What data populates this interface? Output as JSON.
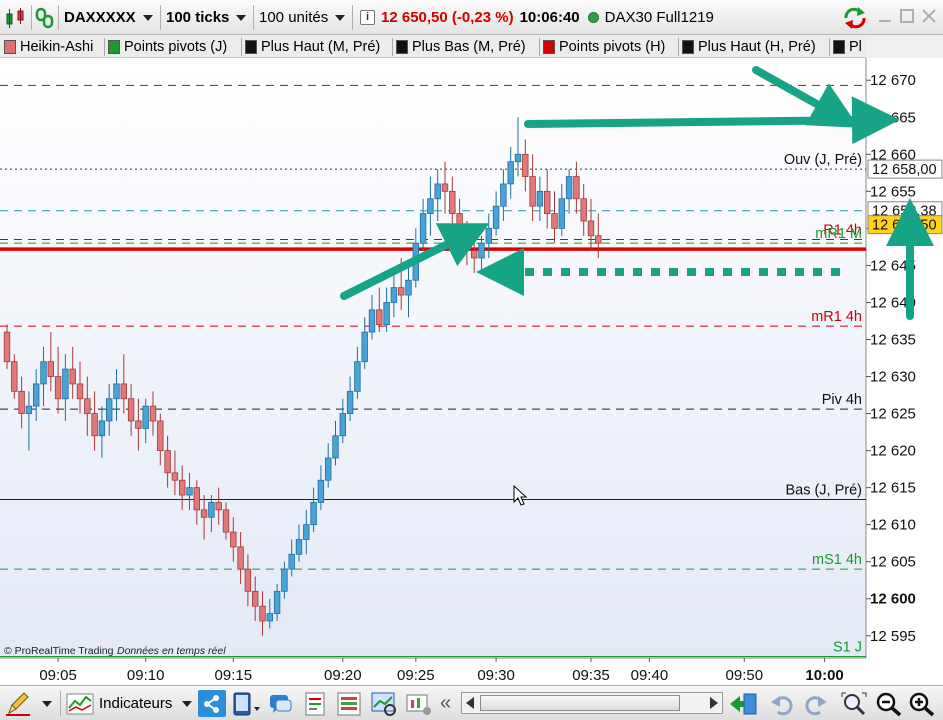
{
  "toolbar": {
    "instrument": "DAXXXXX",
    "period": "100 ticks",
    "units": "100 unités",
    "last_price": "12 650,50",
    "change": "(-0,23 %)",
    "time": "10:06:40",
    "feed_label": "DAX30 Full1219"
  },
  "tabs": [
    {
      "label": "Heikin-Ashi",
      "color": "#e07070"
    },
    {
      "label": "Points pivots (J)",
      "color": "#1a9a30"
    },
    {
      "label": "Plus Haut (M, Pré)",
      "color": "#111111"
    },
    {
      "label": "Plus Bas (M, Pré)",
      "color": "#111111"
    },
    {
      "label": "Points pivots (H)",
      "color": "#d40000"
    },
    {
      "label": "Plus Haut (H, Pré)",
      "color": "#111111"
    },
    {
      "label": "Pl",
      "color": "#111111"
    }
  ],
  "chart_data": {
    "type": "candlestick",
    "ylim": [
      12592,
      12673
    ],
    "yticks": [
      12595,
      12600,
      12605,
      12610,
      12615,
      12620,
      12625,
      12630,
      12635,
      12640,
      12645,
      12650,
      12655,
      12660,
      12665,
      12670
    ],
    "ytick_labels": [
      "12 595",
      "12 600",
      "12 605",
      "12 610",
      "12 615",
      "12 620",
      "12 625",
      "12 630",
      "12 635",
      "12 640",
      "12 645",
      "12 650",
      "12 655",
      "12 660",
      "12 665",
      "12 670"
    ],
    "xticks": [
      {
        "label": "09:05",
        "i": 7
      },
      {
        "label": "09:10",
        "i": 19
      },
      {
        "label": "09:15",
        "i": 31
      },
      {
        "label": "09:20",
        "i": 46
      },
      {
        "label": "09:25",
        "i": 56
      },
      {
        "label": "09:30",
        "i": 67
      },
      {
        "label": "09:35",
        "i": 80
      },
      {
        "label": "09:40",
        "i": 88
      },
      {
        "label": "09:50",
        "i": 101
      },
      {
        "label": "10:00",
        "i": 112
      }
    ],
    "level_lines": [
      {
        "name": "Ouv (J, Pré)",
        "value": 12658.0,
        "color": "#333333",
        "style": "dotted",
        "label_color": "#111111"
      },
      {
        "name": "",
        "value": 12652.38,
        "color": "#2a9aa8",
        "style": "dashed",
        "label_color": "#2a9aa8"
      },
      {
        "name": "R1 4h",
        "value": 12648.5,
        "color": "#d40000",
        "style": "dashed",
        "label_color": "#d40000"
      },
      {
        "name": "mR1 M",
        "value": 12648.0,
        "color": "#1a9a30",
        "style": "dashed",
        "label_color": "#1a9a30"
      },
      {
        "name": "",
        "value": 12647.2,
        "color": "#e00000",
        "style": "solid-thick",
        "label_color": "#e00000"
      },
      {
        "name": "mR1 4h",
        "value": 12636.8,
        "color": "#d40000",
        "style": "dashed",
        "label_color": "#d40000"
      },
      {
        "name": "Piv 4h",
        "value": 12625.6,
        "color": "#222222",
        "style": "dashed",
        "label_color": "#111111"
      },
      {
        "name": "Bas (J, Pré)",
        "value": 12613.4,
        "color": "#222222",
        "style": "solid",
        "label_color": "#111111"
      },
      {
        "name": "mS1 4h",
        "value": 12604.0,
        "color": "#1a9a30",
        "style": "dashed",
        "label_color": "#1a9a30"
      },
      {
        "name": "S1 J",
        "value": 12592.2,
        "color": "#1a9a30",
        "style": "solid",
        "label_color": "#1a9a30"
      },
      {
        "name": "",
        "value": 12669.3,
        "color": "#d40000",
        "style": "dashed",
        "label_color": "#d40000"
      }
    ],
    "price_tags": [
      {
        "value": 12658.0,
        "label": "12 658,00",
        "bg": "#ffffff",
        "fg": "#111111"
      },
      {
        "value": 12652.38,
        "label": "12 652,38",
        "bg": "#ffffff",
        "fg": "#111111"
      },
      {
        "value": 12650.5,
        "label": "12 650,50",
        "bg": "#ffd21e",
        "fg": "#111111"
      }
    ],
    "candles": [
      [
        12636,
        12637,
        12631,
        12632
      ],
      [
        12632,
        12633,
        12627,
        12628
      ],
      [
        12628,
        12630,
        12623,
        12625
      ],
      [
        12625,
        12628,
        12620,
        12626
      ],
      [
        12626,
        12631,
        12624,
        12629
      ],
      [
        12629,
        12634,
        12626,
        12632
      ],
      [
        12632,
        12636,
        12628,
        12630
      ],
      [
        12630,
        12634,
        12625,
        12627
      ],
      [
        12627,
        12633,
        12624,
        12631
      ],
      [
        12631,
        12634,
        12627,
        12629
      ],
      [
        12629,
        12632,
        12625,
        12627
      ],
      [
        12627,
        12630,
        12622,
        12625
      ],
      [
        12625,
        12628,
        12620,
        12622
      ],
      [
        12622,
        12626,
        12619,
        12624
      ],
      [
        12624,
        12629,
        12622,
        12627
      ],
      [
        12627,
        12631,
        12624,
        12629
      ],
      [
        12629,
        12633,
        12625,
        12627
      ],
      [
        12627,
        12629,
        12622,
        12624
      ],
      [
        12624,
        12627,
        12620,
        12623
      ],
      [
        12623,
        12627,
        12621,
        12626
      ],
      [
        12626,
        12628,
        12622,
        12624
      ],
      [
        12624,
        12625,
        12618,
        12620
      ],
      [
        12620,
        12622,
        12615,
        12617
      ],
      [
        12617,
        12620,
        12614,
        12616
      ],
      [
        12616,
        12618,
        12612,
        12614
      ],
      [
        12614,
        12617,
        12612,
        12615
      ],
      [
        12615,
        12616,
        12610,
        12612
      ],
      [
        12612,
        12614,
        12608,
        12611
      ],
      [
        12611,
        12614,
        12609,
        12613
      ],
      [
        12613,
        12615,
        12610,
        12612
      ],
      [
        12612,
        12613,
        12608,
        12609
      ],
      [
        12609,
        12611,
        12605,
        12607
      ],
      [
        12607,
        12609,
        12602,
        12604
      ],
      [
        12604,
        12606,
        12599,
        12601
      ],
      [
        12601,
        12603,
        12597,
        12599
      ],
      [
        12599,
        12601,
        12595,
        12597
      ],
      [
        12597,
        12600,
        12596,
        12598
      ],
      [
        12598,
        12602,
        12597,
        12601
      ],
      [
        12601,
        12605,
        12600,
        12604
      ],
      [
        12604,
        12608,
        12603,
        12606
      ],
      [
        12606,
        12610,
        12605,
        12608
      ],
      [
        12608,
        12612,
        12606,
        12610
      ],
      [
        12610,
        12615,
        12609,
        12613
      ],
      [
        12613,
        12618,
        12612,
        12616
      ],
      [
        12616,
        12621,
        12615,
        12619
      ],
      [
        12619,
        12624,
        12618,
        12622
      ],
      [
        12622,
        12627,
        12621,
        12625
      ],
      [
        12625,
        12630,
        12624,
        12628
      ],
      [
        12628,
        12634,
        12627,
        12632
      ],
      [
        12632,
        12638,
        12631,
        12636
      ],
      [
        12636,
        12641,
        12635,
        12639
      ],
      [
        12639,
        12642,
        12636,
        12637
      ],
      [
        12637,
        12642,
        12636,
        12640
      ],
      [
        12640,
        12644,
        12638,
        12642
      ],
      [
        12642,
        12646,
        12639,
        12641
      ],
      [
        12641,
        12645,
        12638,
        12643
      ],
      [
        12643,
        12650,
        12642,
        12648
      ],
      [
        12648,
        12654,
        12647,
        12652
      ],
      [
        12652,
        12657,
        12649,
        12654
      ],
      [
        12654,
        12658,
        12651,
        12656
      ],
      [
        12656,
        12659,
        12652,
        12655
      ],
      [
        12655,
        12657,
        12650,
        12652
      ],
      [
        12652,
        12654,
        12647,
        12649
      ],
      [
        12649,
        12651,
        12645,
        12647
      ],
      [
        12647,
        12649,
        12644,
        12646
      ],
      [
        12646,
        12649,
        12644,
        12648
      ],
      [
        12648,
        12652,
        12646,
        12650
      ],
      [
        12650,
        12655,
        12649,
        12653
      ],
      [
        12653,
        12658,
        12651,
        12656
      ],
      [
        12656,
        12661,
        12654,
        12659
      ],
      [
        12659,
        12665,
        12657,
        12660
      ],
      [
        12660,
        12662,
        12655,
        12657
      ],
      [
        12657,
        12660,
        12651,
        12653
      ],
      [
        12653,
        12657,
        12651,
        12655
      ],
      [
        12655,
        12658,
        12650,
        12652
      ],
      [
        12652,
        12655,
        12648,
        12650
      ],
      [
        12650,
        12656,
        12649,
        12654
      ],
      [
        12654,
        12658,
        12652,
        12657
      ],
      [
        12657,
        12659,
        12652,
        12654
      ],
      [
        12654,
        12656,
        12649,
        12651
      ],
      [
        12651,
        12654,
        12647,
        12649
      ],
      [
        12649,
        12652,
        12646,
        12648
      ]
    ],
    "arrows": [
      {
        "type": "solid",
        "from": [
          344,
          296
        ],
        "to": [
          468,
          234
        ]
      },
      {
        "type": "solid",
        "from": [
          528,
          124
        ],
        "to": [
          876,
          120
        ]
      },
      {
        "type": "solid",
        "from": [
          756,
          70
        ],
        "to": [
          838,
          116
        ]
      },
      {
        "type": "dotted",
        "from": [
          840,
          272
        ],
        "to": [
          500,
          272
        ]
      },
      {
        "type": "solid",
        "from": [
          910,
          316
        ],
        "to": [
          910,
          222
        ]
      }
    ],
    "copyright": "© ProRealTime Trading",
    "realtime_note": "Données en temps réel"
  },
  "bottombar": {
    "indicators_label": "Indicateurs"
  }
}
